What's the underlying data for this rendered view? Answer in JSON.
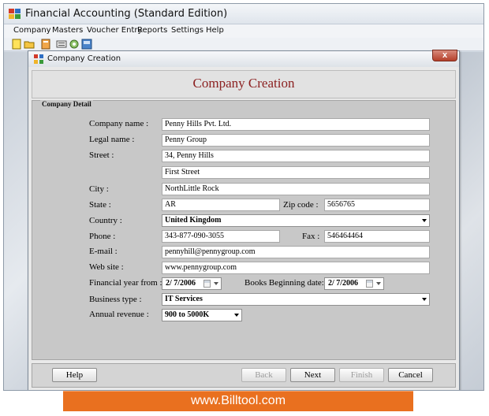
{
  "app": {
    "title": "Financial Accounting (Standard Edition)"
  },
  "menu": [
    "Company",
    "Masters",
    "Voucher Entry",
    "Reports",
    "Settings",
    "Help"
  ],
  "toolbar_icons": [
    "new-company-icon",
    "open-company-icon",
    "calculator-icon",
    "report-icon",
    "settings-icon",
    "export-icon"
  ],
  "dialog": {
    "window_title": "Company Creation",
    "close_label": "x",
    "header": "Company Creation",
    "group_title": "Company Detail",
    "labels": {
      "company_name": "Company name :",
      "legal_name": "Legal name :",
      "street": "Street :",
      "city": "City :",
      "state": "State :",
      "zip": "Zip code :",
      "country": "Country :",
      "phone": "Phone :",
      "fax": "Fax :",
      "email": "E-mail :",
      "website": "Web site :",
      "fy_from": "Financial year from :",
      "books_begin": "Books Beginning date:",
      "business_type": "Business type :",
      "annual_revenue": "Annual revenue :"
    },
    "values": {
      "company_name": "Penny Hills Pvt. Ltd.",
      "legal_name": "Penny Group",
      "street1": "34, Penny Hills",
      "street2": "First Street",
      "city": "NorthLittle Rock",
      "state": "AR",
      "zip": "5656765",
      "country": "United Kingdom",
      "phone": "343-877-090-3055",
      "fax": "546464464",
      "email": "pennyhill@pennygroup.com",
      "website": "www.pennygroup.com",
      "fy_from": "2/ 7/2006",
      "books_begin": "2/ 7/2006",
      "business_type": "IT Services",
      "annual_revenue": "900 to 5000K"
    },
    "buttons": {
      "help": "Help",
      "back": "Back",
      "next": "Next",
      "finish": "Finish",
      "cancel": "Cancel"
    }
  },
  "banner": "www.Billtool.com",
  "colors": {
    "header_title": "#8c2121",
    "banner_bg": "#e9701f",
    "close_button": "#b5402b"
  }
}
